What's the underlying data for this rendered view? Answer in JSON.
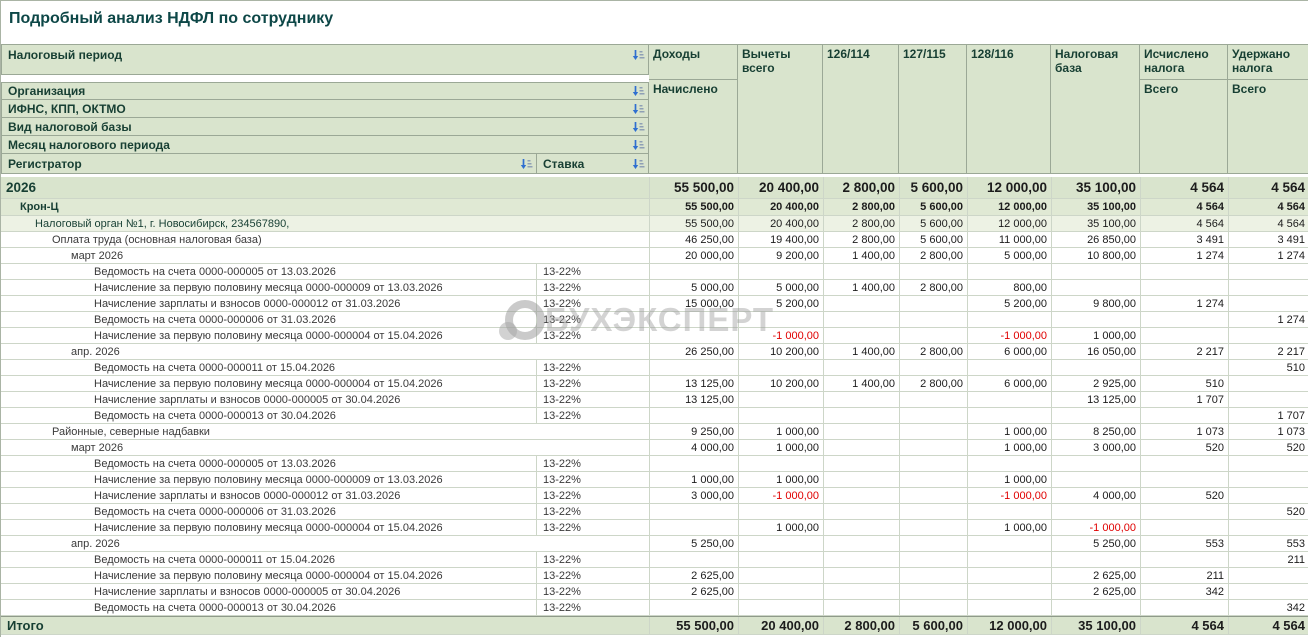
{
  "title": "Подробный анализ НДФЛ по сотруднику",
  "watermark": {
    "text": "БУХЭКСПЕРТ"
  },
  "colors": {
    "header_bg": "#d9e4cd",
    "band1_bg": "#e0e9d4",
    "band2_bg": "#edf2e4",
    "header_text": "#173f33",
    "title_text": "#0d4747",
    "negative": "#e00000",
    "sort_blue": "#2f6fd0"
  },
  "icons": {
    "sort": "sort-icon",
    "watermark_logo": "buhexpert-logo-icon"
  },
  "header": {
    "filter_rows": [
      "Налоговый период",
      "Организация",
      "ИФНС, КПП, ОКТМО",
      "Вид налоговой базы",
      "Месяц налогового периода"
    ],
    "registrator_label": "Регистратор",
    "rate_label": "Ставка",
    "columns": [
      {
        "label": "Доходы",
        "sub": "Начислено"
      },
      {
        "label": "Вычеты всего",
        "sub": null
      },
      {
        "label": "126/114",
        "sub": null
      },
      {
        "label": "127/115",
        "sub": null
      },
      {
        "label": "128/116",
        "sub": null
      },
      {
        "label": "Налоговая база",
        "sub": null
      },
      {
        "label": "Исчислено налога",
        "sub": "Всего"
      },
      {
        "label": "Удержано налога",
        "sub": "Всего"
      }
    ]
  },
  "rows": [
    {
      "label": "2026",
      "level": 0,
      "style": "year",
      "rate": null,
      "values": [
        "55 500,00",
        "20 400,00",
        "2 800,00",
        "5 600,00",
        "12 000,00",
        "35 100,00",
        "4 564",
        "4 564"
      ]
    },
    {
      "label": "Крон-Ц",
      "level": 1,
      "style": "company",
      "rate": null,
      "values": [
        "55 500,00",
        "20 400,00",
        "2 800,00",
        "5 600,00",
        "12 000,00",
        "35 100,00",
        "4 564",
        "4 564"
      ]
    },
    {
      "label": "Налоговый орган №1, г. Новосибирск, 234567890,",
      "level": 2,
      "style": "inspection",
      "rate": null,
      "values": [
        "55 500,00",
        "20 400,00",
        "2 800,00",
        "5 600,00",
        "12 000,00",
        "35 100,00",
        "4 564",
        "4 564"
      ]
    },
    {
      "label": "Оплата труда (основная налоговая база)",
      "level": 3,
      "style": "group",
      "rate": null,
      "values": [
        "46 250,00",
        "19 400,00",
        "2 800,00",
        "5 600,00",
        "11 000,00",
        "26 850,00",
        "3 491",
        "3 491"
      ]
    },
    {
      "label": "март 2026",
      "level": 4,
      "style": "group",
      "rate": null,
      "values": [
        "20 000,00",
        "9 200,00",
        "1 400,00",
        "2 800,00",
        "5 000,00",
        "10 800,00",
        "1 274",
        "1 274"
      ]
    },
    {
      "label": "Ведомость на счета 0000-000005 от 13.03.2026",
      "level": 5,
      "style": "detail",
      "rate": "13-22%",
      "values": [
        "",
        "",
        "",
        "",
        "",
        "",
        "",
        ""
      ]
    },
    {
      "label": "Начисление за первую половину месяца 0000-000009 от 13.03.2026",
      "level": 5,
      "style": "detail",
      "rate": "13-22%",
      "values": [
        "5 000,00",
        "5 000,00",
        "1 400,00",
        "2 800,00",
        "800,00",
        "",
        "",
        ""
      ]
    },
    {
      "label": "Начисление зарплаты и взносов 0000-000012 от 31.03.2026",
      "level": 5,
      "style": "detail",
      "rate": "13-22%",
      "values": [
        "15 000,00",
        "5 200,00",
        "",
        "",
        "5 200,00",
        "9 800,00",
        "1 274",
        ""
      ]
    },
    {
      "label": "Ведомость на счета 0000-000006 от 31.03.2026",
      "level": 5,
      "style": "detail",
      "rate": "13-22%",
      "values": [
        "",
        "",
        "",
        "",
        "",
        "",
        "",
        "1 274"
      ]
    },
    {
      "label": "Начисление за первую половину месяца 0000-000004 от 15.04.2026",
      "level": 5,
      "style": "detail",
      "rate": "13-22%",
      "values": [
        "",
        "-1 000,00",
        "",
        "",
        "-1 000,00",
        "1 000,00",
        "",
        ""
      ]
    },
    {
      "label": "апр. 2026",
      "level": 4,
      "style": "group",
      "rate": null,
      "values": [
        "26 250,00",
        "10 200,00",
        "1 400,00",
        "2 800,00",
        "6 000,00",
        "16 050,00",
        "2 217",
        "2 217"
      ]
    },
    {
      "label": "Ведомость на счета 0000-000011 от 15.04.2026",
      "level": 5,
      "style": "detail",
      "rate": "13-22%",
      "values": [
        "",
        "",
        "",
        "",
        "",
        "",
        "",
        "510"
      ]
    },
    {
      "label": "Начисление за первую половину месяца 0000-000004 от 15.04.2026",
      "level": 5,
      "style": "detail",
      "rate": "13-22%",
      "values": [
        "13 125,00",
        "10 200,00",
        "1 400,00",
        "2 800,00",
        "6 000,00",
        "2 925,00",
        "510",
        ""
      ]
    },
    {
      "label": "Начисление зарплаты и взносов 0000-000005 от 30.04.2026",
      "level": 5,
      "style": "detail",
      "rate": "13-22%",
      "values": [
        "13 125,00",
        "",
        "",
        "",
        "",
        "13 125,00",
        "1 707",
        ""
      ]
    },
    {
      "label": "Ведомость на счета 0000-000013 от 30.04.2026",
      "level": 5,
      "style": "detail",
      "rate": "13-22%",
      "values": [
        "",
        "",
        "",
        "",
        "",
        "",
        "",
        "1 707"
      ]
    },
    {
      "label": "Районные, северные надбавки",
      "level": 3,
      "style": "group",
      "rate": null,
      "values": [
        "9 250,00",
        "1 000,00",
        "",
        "",
        "1 000,00",
        "8 250,00",
        "1 073",
        "1 073"
      ]
    },
    {
      "label": "март 2026",
      "level": 4,
      "style": "group",
      "rate": null,
      "values": [
        "4 000,00",
        "1 000,00",
        "",
        "",
        "1 000,00",
        "3 000,00",
        "520",
        "520"
      ]
    },
    {
      "label": "Ведомость на счета 0000-000005 от 13.03.2026",
      "level": 5,
      "style": "detail",
      "rate": "13-22%",
      "values": [
        "",
        "",
        "",
        "",
        "",
        "",
        "",
        ""
      ]
    },
    {
      "label": "Начисление за первую половину месяца 0000-000009 от 13.03.2026",
      "level": 5,
      "style": "detail",
      "rate": "13-22%",
      "values": [
        "1 000,00",
        "1 000,00",
        "",
        "",
        "1 000,00",
        "",
        "",
        ""
      ]
    },
    {
      "label": "Начисление зарплаты и взносов 0000-000012 от 31.03.2026",
      "level": 5,
      "style": "detail",
      "rate": "13-22%",
      "values": [
        "3 000,00",
        "-1 000,00",
        "",
        "",
        "-1 000,00",
        "4 000,00",
        "520",
        ""
      ]
    },
    {
      "label": "Ведомость на счета 0000-000006 от 31.03.2026",
      "level": 5,
      "style": "detail",
      "rate": "13-22%",
      "values": [
        "",
        "",
        "",
        "",
        "",
        "",
        "",
        "520"
      ]
    },
    {
      "label": "Начисление за первую половину месяца 0000-000004 от 15.04.2026",
      "level": 5,
      "style": "detail",
      "rate": "13-22%",
      "values": [
        "",
        "1 000,00",
        "",
        "",
        "1 000,00",
        "-1 000,00",
        "",
        ""
      ]
    },
    {
      "label": "апр. 2026",
      "level": 4,
      "style": "group",
      "rate": null,
      "values": [
        "5 250,00",
        "",
        "",
        "",
        "",
        "5 250,00",
        "553",
        "553"
      ]
    },
    {
      "label": "Ведомость на счета 0000-000011 от 15.04.2026",
      "level": 5,
      "style": "detail",
      "rate": "13-22%",
      "values": [
        "",
        "",
        "",
        "",
        "",
        "",
        "",
        "211"
      ]
    },
    {
      "label": "Начисление за первую половину месяца 0000-000004 от 15.04.2026",
      "level": 5,
      "style": "detail",
      "rate": "13-22%",
      "values": [
        "2 625,00",
        "",
        "",
        "",
        "",
        "2 625,00",
        "211",
        ""
      ]
    },
    {
      "label": "Начисление зарплаты и взносов 0000-000005 от 30.04.2026",
      "level": 5,
      "style": "detail",
      "rate": "13-22%",
      "values": [
        "2 625,00",
        "",
        "",
        "",
        "",
        "2 625,00",
        "342",
        ""
      ]
    },
    {
      "label": "Ведомость на счета 0000-000013 от 30.04.2026",
      "level": 5,
      "style": "detail",
      "rate": "13-22%",
      "values": [
        "",
        "",
        "",
        "",
        "",
        "",
        "",
        "342"
      ]
    }
  ],
  "footer": {
    "label": "Итого",
    "values": [
      "55 500,00",
      "20 400,00",
      "2 800,00",
      "5 600,00",
      "12 000,00",
      "35 100,00",
      "4 564",
      "4 564"
    ]
  }
}
